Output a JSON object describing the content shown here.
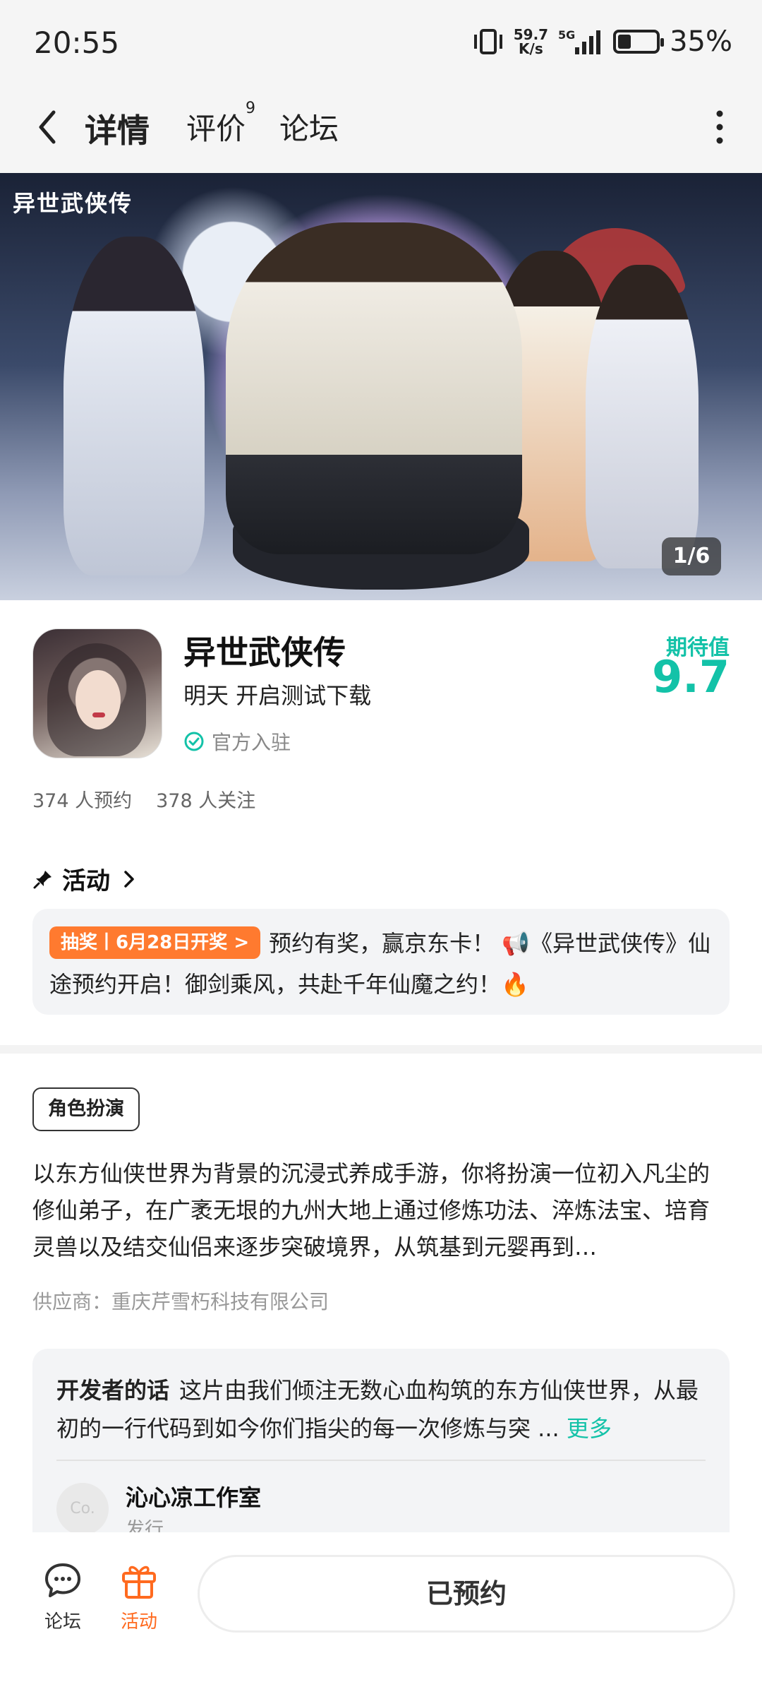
{
  "status_bar": {
    "time": "20:55",
    "net_speed_value": "59.7",
    "net_speed_unit": "K/s",
    "network": "5G",
    "battery_percent": "35%",
    "battery_level": 0.35
  },
  "nav": {
    "tabs": [
      {
        "label": "详情",
        "active": true
      },
      {
        "label": "评价",
        "badge": "9"
      },
      {
        "label": "论坛"
      }
    ]
  },
  "banner": {
    "logo_text": "异世武侠传",
    "counter": "1/6"
  },
  "app": {
    "name": "异世武侠传",
    "subtitle": "明天 开启测试下载",
    "official_label": "官方入驻",
    "score_label": "期待值",
    "score": "9.7",
    "reservations": "374 人预约",
    "followers": "378 人关注"
  },
  "activity": {
    "header": "活动",
    "badge": "抽奖丨6月28日开奖 >",
    "text": "预约有奖，赢京东卡！ 📢《异世武侠传》仙途预约开启！御剑乘风，共赴千年仙魔之约！🔥"
  },
  "description": {
    "genre_tag": "角色扮演",
    "text": "以东方仙侠世界为背景的沉浸式养成手游，你将扮演一位初入凡尘的修仙弟子，在广袤无垠的九州大地上通过修炼功法、淬炼法宝、培育灵兽以及结交仙侣来逐步突破境界，从筑基到元婴再到…",
    "supplier": "供应商：重庆芹雪朽科技有限公司"
  },
  "developer": {
    "title": "开发者的话",
    "text": "这片由我们倾注无数心血构筑的东方仙侠世界，从最初的一行代码到如今你们指尖的每一次修炼与突 ...",
    "more": "更多",
    "avatar_text": "Co.",
    "studio_name": "沁心凉工作室",
    "studio_role": "发行"
  },
  "bottom_bar": {
    "forum_label": "论坛",
    "activity_label": "活动",
    "action_button": "已预约"
  },
  "colors": {
    "accent": "#13c2a8",
    "orange": "#ff7a2f"
  }
}
